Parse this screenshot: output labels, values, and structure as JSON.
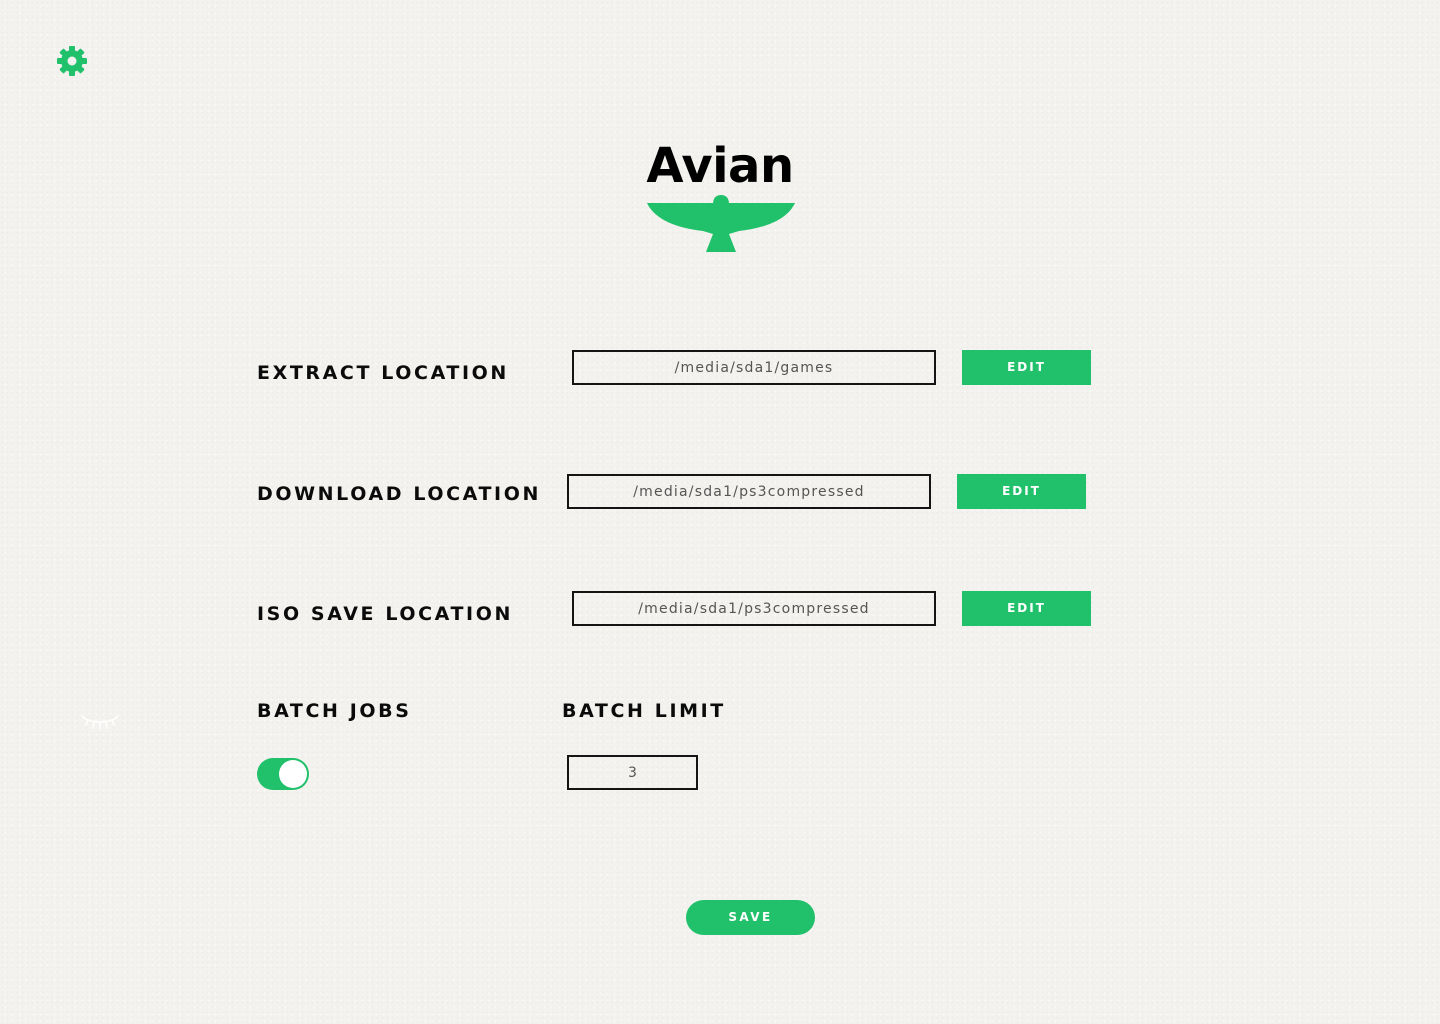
{
  "header": {
    "settings_icon": "gear-icon",
    "app_name": "Avian",
    "logo_icon": "bird-icon"
  },
  "settings": {
    "extract": {
      "label": "EXTRACT LOCATION",
      "value": "/media/sda1/games",
      "button": "EDIT"
    },
    "download": {
      "label": "DOWNLOAD LOCATION",
      "value": "/media/sda1/ps3compressed",
      "button": "EDIT"
    },
    "iso_save": {
      "label": "ISO SAVE LOCATION",
      "value": "/media/sda1/ps3compressed",
      "button": "EDIT"
    },
    "batch_jobs": {
      "label": "BATCH JOBS",
      "enabled": true
    },
    "batch_limit": {
      "label": "BATCH LIMIT",
      "value": "3"
    }
  },
  "hidden_icon": "eye-closed-icon",
  "save_button": "SAVE",
  "colors": {
    "accent": "#21c16b",
    "background": "#f3f2ee",
    "text": "#0b0b0b"
  }
}
